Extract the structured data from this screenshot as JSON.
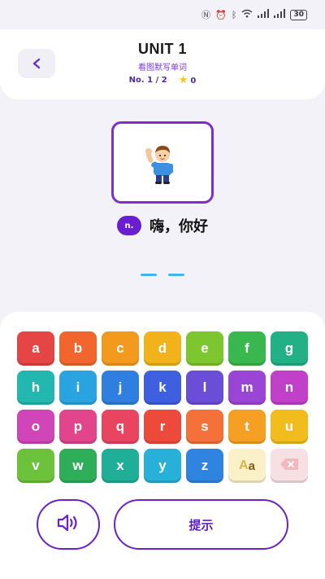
{
  "status_bar": {
    "icons": [
      "nfc-icon",
      "alarm-icon",
      "bluetooth-icon",
      "wifi-icon",
      "signal-icon",
      "signal-icon"
    ],
    "battery": "30"
  },
  "header": {
    "title": "UNIT 1",
    "subtitle": "看图默写单词",
    "progress": "No. 1 / 2",
    "stars": "0"
  },
  "word": {
    "picture": "waving-boy-image",
    "part_of_speech": "n.",
    "meaning": "嗨，你好",
    "blank_count": 2
  },
  "keyboard": {
    "keys": [
      {
        "label": "a",
        "color": "#e64545"
      },
      {
        "label": "b",
        "color": "#f2662e"
      },
      {
        "label": "c",
        "color": "#f39a1e"
      },
      {
        "label": "d",
        "color": "#f2b21a"
      },
      {
        "label": "e",
        "color": "#7dc62f"
      },
      {
        "label": "f",
        "color": "#38b84e"
      },
      {
        "label": "g",
        "color": "#22b085"
      },
      {
        "label": "h",
        "color": "#22b8b0"
      },
      {
        "label": "i",
        "color": "#2aa4e0"
      },
      {
        "label": "j",
        "color": "#2e7fe0"
      },
      {
        "label": "k",
        "color": "#3d5fe0"
      },
      {
        "label": "l",
        "color": "#6a4ed8"
      },
      {
        "label": "m",
        "color": "#9b45d6"
      },
      {
        "label": "n",
        "color": "#c23fc9"
      },
      {
        "label": "o",
        "color": "#d045b8"
      },
      {
        "label": "p",
        "color": "#e2458c"
      },
      {
        "label": "q",
        "color": "#ea4560"
      },
      {
        "label": "r",
        "color": "#ee4a3c"
      },
      {
        "label": "s",
        "color": "#f5713a"
      },
      {
        "label": "t",
        "color": "#f5a023"
      },
      {
        "label": "u",
        "color": "#f2bc1d"
      },
      {
        "label": "v",
        "color": "#6cc23a"
      },
      {
        "label": "w",
        "color": "#2fae5a"
      },
      {
        "label": "x",
        "color": "#1fae98"
      },
      {
        "label": "y",
        "color": "#27b0d8"
      },
      {
        "label": "z",
        "color": "#2f84e0"
      }
    ],
    "case_key": {
      "upper": "A",
      "lower": "a"
    },
    "backspace_icon": "backspace-icon"
  },
  "actions": {
    "sound_icon": "speaker-icon",
    "hint_label": "提示"
  },
  "colors": {
    "accent": "#6a22c8",
    "blank": "#45b4ea",
    "star": "#f5c518"
  }
}
